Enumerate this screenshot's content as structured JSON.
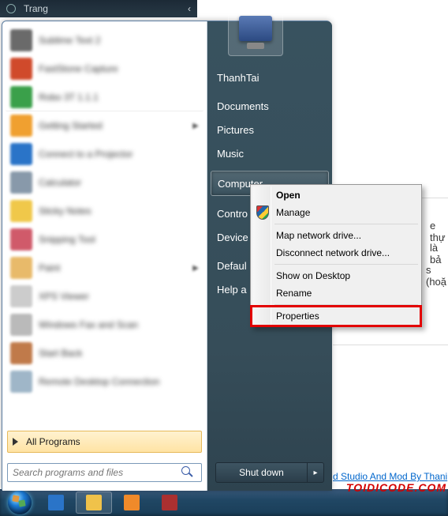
{
  "window_top": {
    "title": "Trang"
  },
  "backdrop": {
    "text1": "e thự",
    "text2": "là bả",
    "text3": "s (hoặ",
    "bottom_link": "d Studio And Mod By Thani"
  },
  "watermark": "TOIDICODE.COM",
  "left_pane": {
    "pinned": [
      {
        "label": "Sublime Text 2",
        "color": "#6a6a6a",
        "arrow": false
      },
      {
        "label": "FastStone Capture",
        "color": "#d04a2b",
        "arrow": false
      },
      {
        "label": "Robo 3T 1.1.1",
        "color": "#3aa04a",
        "arrow": false,
        "sep": true
      },
      {
        "label": "Getting Started",
        "color": "#f0a030",
        "arrow": true
      },
      {
        "label": "Connect to a Projector",
        "color": "#2a74c8",
        "arrow": false
      },
      {
        "label": "Calculator",
        "color": "#8899aa",
        "arrow": false
      },
      {
        "label": "Sticky Notes",
        "color": "#f0c84a",
        "arrow": false
      },
      {
        "label": "Snipping Tool",
        "color": "#d05a6a",
        "arrow": false
      },
      {
        "label": "Paint",
        "color": "#e8ba6a",
        "arrow": true
      },
      {
        "label": "XPS Viewer",
        "color": "#cccccc",
        "arrow": false
      },
      {
        "label": "Windows Fax and Scan",
        "color": "#bababa",
        "arrow": false
      },
      {
        "label": "Start Back",
        "color": "#c07a4a",
        "arrow": false
      },
      {
        "label": "Remote Desktop Connection",
        "color": "#9fb6c8",
        "arrow": false
      }
    ],
    "all_programs": "All Programs",
    "search_placeholder": "Search programs and files"
  },
  "right_pane": {
    "username": "ThanhTai",
    "items": [
      "Documents",
      "Pictures",
      "Music",
      "Computer",
      "Control Panel",
      "Devices and Printers",
      "Default Programs",
      "Help and Support"
    ],
    "highlighted_index": 3,
    "shutdown": "Shut down"
  },
  "context_menu": {
    "items": [
      {
        "label": "Open",
        "bold": true,
        "icon": null
      },
      {
        "label": "Manage",
        "bold": false,
        "icon": "shield"
      },
      {
        "sep": true
      },
      {
        "label": "Map network drive...",
        "bold": false
      },
      {
        "label": "Disconnect network drive...",
        "bold": false
      },
      {
        "sep": true
      },
      {
        "label": "Show on Desktop",
        "bold": false
      },
      {
        "label": "Rename",
        "bold": false
      },
      {
        "sep": true
      },
      {
        "label": "Properties",
        "bold": false,
        "redbox": true
      }
    ]
  },
  "taskbar": {
    "buttons": [
      {
        "name": "ie-icon",
        "color": "#2a74c8"
      },
      {
        "name": "explorer-icon",
        "color": "#f0c24a",
        "active": true
      },
      {
        "name": "wmp-icon",
        "color": "#f08a2a"
      },
      {
        "name": "app-icon",
        "color": "#aa3030"
      }
    ]
  }
}
